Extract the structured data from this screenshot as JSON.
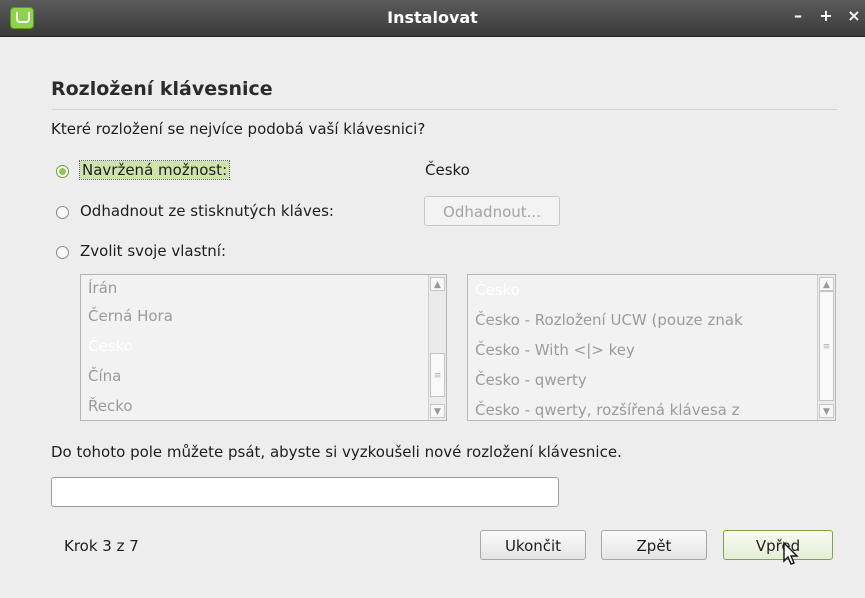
{
  "window": {
    "title": "Instalovat",
    "minimize_label": "–",
    "maximize_label": "+",
    "close_label": "×"
  },
  "page": {
    "heading": "Rozložení klávesnice",
    "question": "Které rozložení se nejvíce podobá vaší klávesnici?"
  },
  "options": {
    "suggested": {
      "label": "Navržená možnost:",
      "value": "Česko",
      "checked": true
    },
    "detect": {
      "label": "Odhadnout ze stisknutých kláves:",
      "button": "Odhadnout..."
    },
    "choose": {
      "label": "Zvolit svoje vlastní:"
    }
  },
  "layouts": {
    "countries": [
      "Írán",
      "Černá Hora",
      "Česko",
      "Čína",
      "Řecko"
    ],
    "selected_country": "Česko",
    "variants": [
      "Česko",
      "Česko - Rozložení UCW (pouze znak",
      "Česko - With <|> key",
      "Česko - qwerty",
      "Česko - qwerty, rozšířená klávesa z"
    ],
    "selected_variant": "Česko"
  },
  "test": {
    "hint": "Do tohoto pole můžete psát, abyste si vyzkoušeli nové rozložení klávesnice.",
    "value": ""
  },
  "footer": {
    "step": "Krok 3 z 7",
    "quit": "Ukončit",
    "back": "Zpět",
    "forward": "Vpřed"
  },
  "colors": {
    "accent": "#8ec64c",
    "titlebar": "#3f3f3f"
  }
}
